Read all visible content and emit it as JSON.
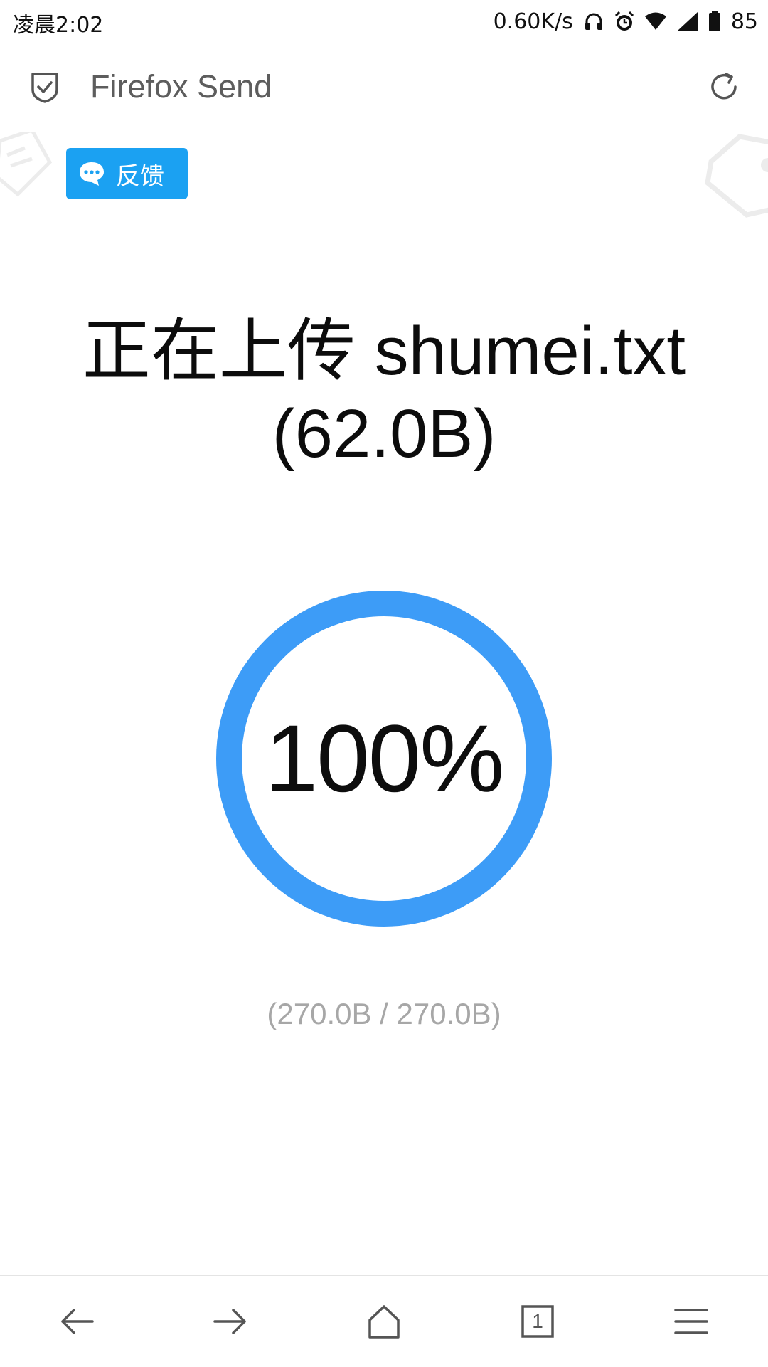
{
  "status_bar": {
    "time": "凌晨2:02",
    "net_speed": "0.60K/s",
    "battery": "85",
    "icons": [
      "headphones-icon",
      "alarm-icon",
      "wifi-icon",
      "signal-icon",
      "battery-icon"
    ]
  },
  "toolbar": {
    "title": "Firefox Send",
    "icons": [
      "shield-icon",
      "reload-icon"
    ]
  },
  "feedback": {
    "label": "反馈",
    "icon": "chat-icon",
    "color": "#1ba1f2"
  },
  "upload": {
    "title_line1": "正在上传 shumei.txt",
    "title_line2": "(62.0B)",
    "percent_label": "100%",
    "progress_fraction": 1.0,
    "bytes_label": "(270.0B / 270.0B)",
    "ring_color": "#3d9cf7"
  },
  "bottom_nav": {
    "tab_count": "1",
    "icons": [
      "back-arrow-icon",
      "forward-arrow-icon",
      "home-icon",
      "tabs-icon",
      "menu-icon"
    ]
  }
}
